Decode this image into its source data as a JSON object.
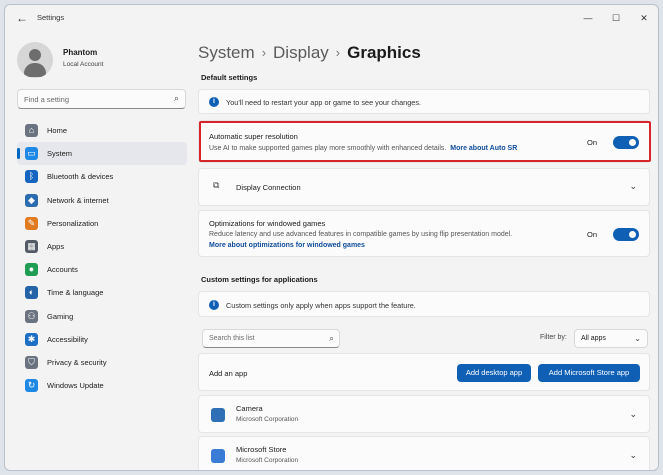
{
  "window": {
    "title": "Settings",
    "back_icon": "←",
    "minimize": "—",
    "maximize": "☐",
    "close": "✕"
  },
  "profile": {
    "name": "Phantom",
    "account": "Local Account"
  },
  "search": {
    "placeholder": "Find a setting",
    "icon": "⌕"
  },
  "sidebar": {
    "items": [
      {
        "label": "Home",
        "icon": "home-icon",
        "glyph": "⌂",
        "color": "#6b7280"
      },
      {
        "label": "System",
        "icon": "monitor-icon",
        "glyph": "▭",
        "color": "#1e88e5"
      },
      {
        "label": "Bluetooth & devices",
        "icon": "bluetooth-icon",
        "glyph": "ᛒ",
        "color": "#1565c0"
      },
      {
        "label": "Network & internet",
        "icon": "wifi-icon",
        "glyph": "◆",
        "color": "#2b6cb0"
      },
      {
        "label": "Personalization",
        "icon": "brush-icon",
        "glyph": "✎",
        "color": "#e07b1f"
      },
      {
        "label": "Apps",
        "icon": "apps-icon",
        "glyph": "▦",
        "color": "#555b66"
      },
      {
        "label": "Accounts",
        "icon": "account-icon",
        "glyph": "●",
        "color": "#1f9d55"
      },
      {
        "label": "Time & language",
        "icon": "globe-icon",
        "glyph": "◐",
        "color": "#2563a8"
      },
      {
        "label": "Gaming",
        "icon": "gamepad-icon",
        "glyph": "⚇",
        "color": "#6b7280"
      },
      {
        "label": "Accessibility",
        "icon": "accessibility-icon",
        "glyph": "✱",
        "color": "#1d6fc4"
      },
      {
        "label": "Privacy & security",
        "icon": "shield-icon",
        "glyph": "⛉",
        "color": "#6b7280"
      },
      {
        "label": "Windows Update",
        "icon": "update-icon",
        "glyph": "↻",
        "color": "#1e88e5"
      }
    ]
  },
  "breadcrumb": {
    "part1": "System",
    "part2": "Display",
    "current": "Graphics",
    "sep": "›"
  },
  "default_settings": {
    "heading": "Default settings",
    "restart_notice": "You'll need to restart your app or game to see your changes.",
    "auto_sr": {
      "title": "Automatic super resolution",
      "desc": "Use AI to make supported games play more smoothly with enhanced details.",
      "link": "More about Auto SR",
      "state": "On"
    },
    "display_connection": {
      "title": "Display Connection"
    },
    "windowed_games": {
      "title": "Optimizations for windowed games",
      "desc": "Reduce latency and use advanced features in compatible games by using flip presentation model.",
      "link": "More about optimizations for windowed games",
      "state": "On"
    }
  },
  "custom_settings": {
    "heading": "Custom settings for applications",
    "notice": "Custom settings only apply when apps support the feature.",
    "search_placeholder": "Search this list",
    "filter_label": "Filter by:",
    "filter_value": "All apps",
    "add_app_label": "Add an app",
    "add_desktop_btn": "Add desktop app",
    "add_store_btn": "Add Microsoft Store app",
    "apps": [
      {
        "name": "Camera",
        "publisher": "Microsoft Corporation",
        "color": "#2e6fb5"
      },
      {
        "name": "Microsoft Store",
        "publisher": "Microsoft Corporation",
        "color": "#3a7bd5"
      }
    ]
  },
  "icons": {
    "chevron_down": "⌄",
    "info": "i",
    "display": "⧉"
  },
  "colors": {
    "accent": "#0f5fb5",
    "highlight": "#d7232a"
  }
}
